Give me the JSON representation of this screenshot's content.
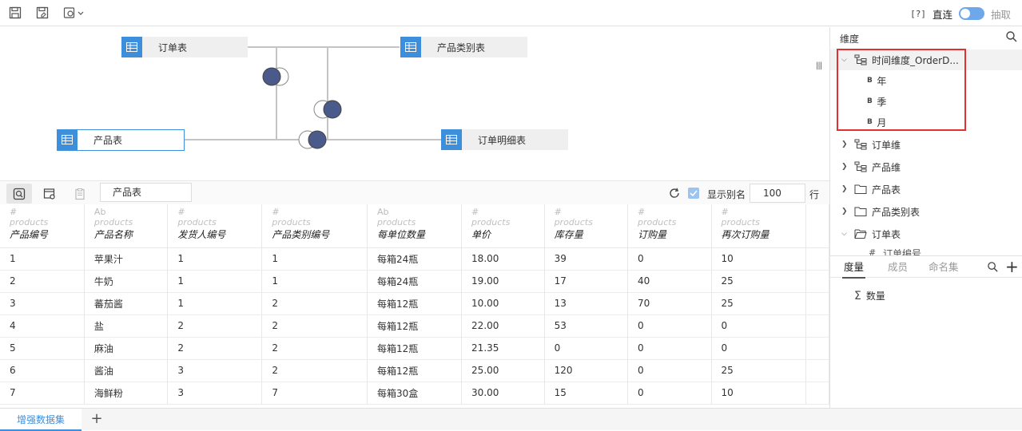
{
  "toolbar": {
    "help": "[?]",
    "direct_label": "直连",
    "extract_label": "抽取",
    "save_icon": "save-icon",
    "save_as_icon": "save-as-icon",
    "settings_icon": "settings-dropdown-icon"
  },
  "canvas": {
    "nodes": [
      {
        "label": "订单表"
      },
      {
        "label": "产品类别表"
      },
      {
        "label": "产品表"
      },
      {
        "label": "订单明细表"
      }
    ],
    "colors": {
      "accent": "#3d8edb",
      "join_fill": "#4a5a8a",
      "line": "#c0c0c0"
    }
  },
  "grid_toolbar": {
    "table_name": "产品表",
    "show_alias_label": "显示别名",
    "row_count": "100",
    "rows_unit": "行"
  },
  "table": {
    "columns": [
      {
        "type": "#",
        "source": "products",
        "name": "产品编号"
      },
      {
        "type": "Ab",
        "source": "products",
        "name": "产品名称"
      },
      {
        "type": "#",
        "source": "products",
        "name": "发货人编号"
      },
      {
        "type": "#",
        "source": "products",
        "name": "产品类别编号"
      },
      {
        "type": "Ab",
        "source": "products",
        "name": "每单位数量"
      },
      {
        "type": "#",
        "source": "products",
        "name": "单价"
      },
      {
        "type": "#",
        "source": "products",
        "name": "库存量"
      },
      {
        "type": "#",
        "source": "products",
        "name": "订购量"
      },
      {
        "type": "#",
        "source": "products",
        "name": "再次订购量"
      }
    ],
    "rows": [
      [
        "1",
        "苹果汁",
        "1",
        "1",
        "每箱24瓶",
        "18.00",
        "39",
        "0",
        "10"
      ],
      [
        "2",
        "牛奶",
        "1",
        "1",
        "每箱24瓶",
        "19.00",
        "17",
        "40",
        "25"
      ],
      [
        "3",
        "蕃茄酱",
        "1",
        "2",
        "每箱12瓶",
        "10.00",
        "13",
        "70",
        "25"
      ],
      [
        "4",
        "盐",
        "2",
        "2",
        "每箱12瓶",
        "22.00",
        "53",
        "0",
        "0"
      ],
      [
        "5",
        "麻油",
        "2",
        "2",
        "每箱12瓶",
        "21.35",
        "0",
        "0",
        "0"
      ],
      [
        "6",
        "酱油",
        "3",
        "2",
        "每箱12瓶",
        "25.00",
        "120",
        "0",
        "25"
      ],
      [
        "7",
        "海鲜粉",
        "3",
        "7",
        "每箱30盒",
        "30.00",
        "15",
        "0",
        "10"
      ]
    ]
  },
  "bottom": {
    "tab_label": "增强数据集",
    "add_label": "+"
  },
  "right_panel": {
    "title": "维度",
    "tree": [
      {
        "label": "时间维度_OrderD...",
        "expanded": true,
        "children": [
          "年",
          "季",
          "月"
        ]
      },
      {
        "label": "订单维",
        "expanded": false
      },
      {
        "label": "产品维",
        "expanded": false
      },
      {
        "label": "产品表",
        "expanded": false
      },
      {
        "label": "产品类别表",
        "expanded": false
      },
      {
        "label": "订单表",
        "expanded": true,
        "children": [
          "订单编号"
        ]
      }
    ],
    "measure_tabs": [
      "度量",
      "成员",
      "命名集"
    ],
    "measures": [
      {
        "label": "数量"
      }
    ],
    "highlight_color": "#e03030"
  }
}
